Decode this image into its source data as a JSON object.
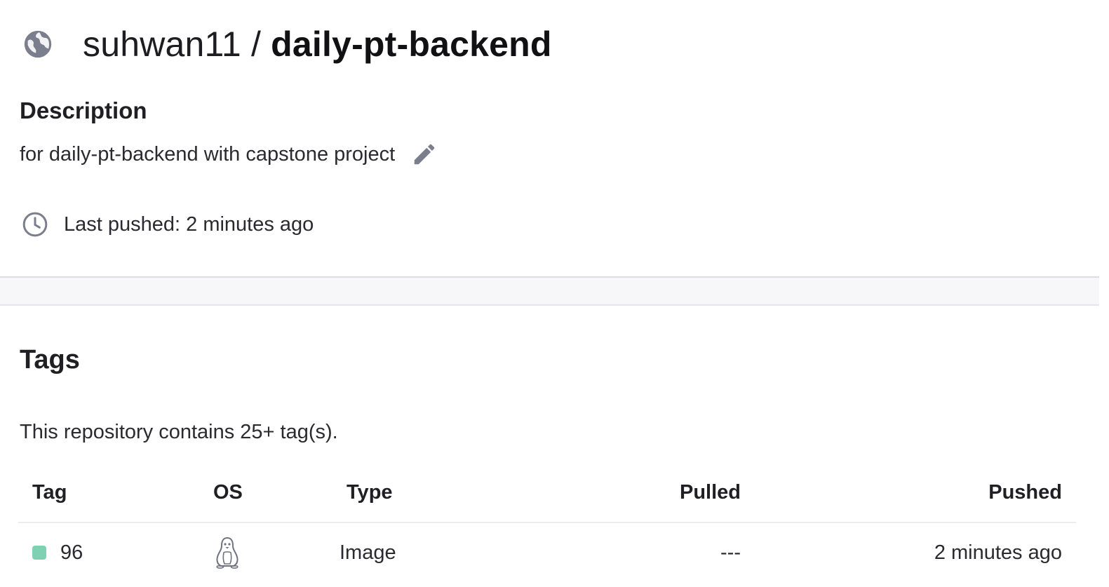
{
  "header": {
    "owner": "suhwan11",
    "separator": "/",
    "repo_name": "daily-pt-backend",
    "icon": "globe-icon"
  },
  "description": {
    "heading": "Description",
    "text": "for daily-pt-backend with capstone project",
    "edit_icon": "pencil-icon"
  },
  "last_pushed": {
    "icon": "clock-icon",
    "text": "Last pushed: 2 minutes ago"
  },
  "tags": {
    "heading": "Tags",
    "count_text": "This repository contains 25+ tag(s).",
    "columns": {
      "tag": "Tag",
      "os": "OS",
      "type": "Type",
      "pulled": "Pulled",
      "pushed": "Pushed"
    },
    "rows": [
      {
        "tag": "96",
        "status_color": "#7fd1b4",
        "os_icon": "linux-penguin-icon",
        "type": "Image",
        "pulled": "---",
        "pushed": "2 minutes ago"
      }
    ]
  },
  "colors": {
    "icon_gray": "#7b7e8c",
    "text": "#2b2a30",
    "band": "#f7f7f9",
    "tag_dot": "#7fd1b4"
  }
}
